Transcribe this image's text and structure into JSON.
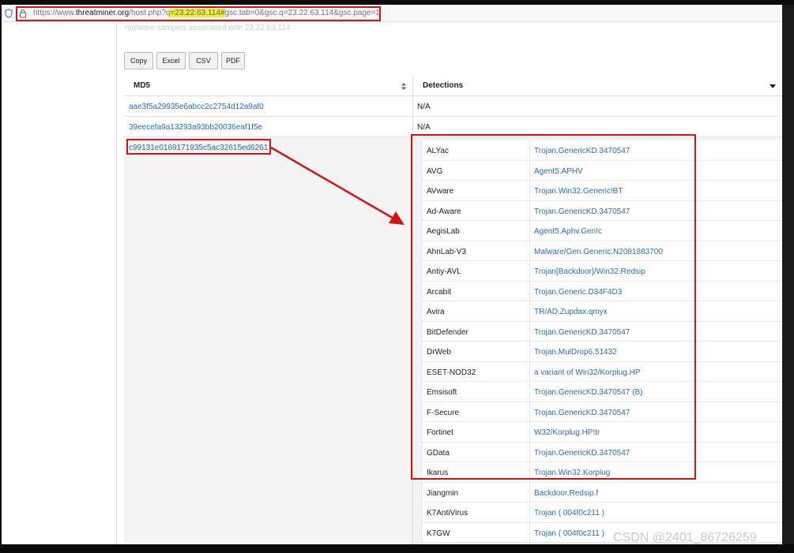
{
  "address_bar": {
    "url_prefix": "https://www.",
    "url_host": "threatminer.org",
    "url_path": "/host.php?q",
    "url_highlight": "=23.22.63.114#",
    "url_rest": "gsc.tab=0&gsc.q=23.22.63.114&gsc.page=1"
  },
  "faded_text": "malware samples associated with 23.22.63.114",
  "toolbar": {
    "buttons": [
      "Copy",
      "Excel",
      "CSV",
      "PDF"
    ]
  },
  "table": {
    "headers": {
      "md5": "MD5",
      "detections": "Detections"
    },
    "rows": [
      {
        "md5": "aae3f5a29935e6abcc2c2754d12a9af0",
        "detections": "N/A"
      },
      {
        "md5": "39eecefa9a13293a93bb20036eaf1f5e",
        "detections": "N/A"
      },
      {
        "md5": "c99131e0169171935c5ac32615ed6261"
      }
    ]
  },
  "detections": [
    {
      "engine": "ALYac",
      "result": "Trojan.GenericKD.3470547"
    },
    {
      "engine": "AVG",
      "result": "Agent5.APHV"
    },
    {
      "engine": "AVware",
      "result": "Trojan.Win32.Generic!BT"
    },
    {
      "engine": "Ad-Aware",
      "result": "Trojan.GenericKD.3470547"
    },
    {
      "engine": "AegisLab",
      "result": "Agent5.Aphv.Gen!c"
    },
    {
      "engine": "AhnLab-V3",
      "result": "Malware/Gen.Generic.N2081883700"
    },
    {
      "engine": "Antiy-AVL",
      "result": "Trojan[Backdoor]/Win32.Redsip"
    },
    {
      "engine": "Arcabit",
      "result": "Trojan.Generic.D34F4D3"
    },
    {
      "engine": "Avira",
      "result": "TR/AD.Zupdax.qmyx"
    },
    {
      "engine": "BitDefender",
      "result": "Trojan.GenericKD.3470547"
    },
    {
      "engine": "DrWeb",
      "result": "Trojan.MulDrop6.51432"
    },
    {
      "engine": "ESET-NOD32",
      "result": "a variant of Win32/Korplug.HP"
    },
    {
      "engine": "Emsisoft",
      "result": "Trojan.GenericKD.3470547 (B)"
    },
    {
      "engine": "F-Secure",
      "result": "Trojan.GenericKD.3470547"
    },
    {
      "engine": "Fortinet",
      "result": "W32/Korplug.HP!tr"
    },
    {
      "engine": "GData",
      "result": "Trojan.GenericKD.3470547"
    },
    {
      "engine": "Ikarus",
      "result": "Trojan.Win32.Korplug"
    },
    {
      "engine": "Jiangmin",
      "result": "Backdoor.Redsip.f"
    },
    {
      "engine": "K7AntiVirus",
      "result": "Trojan ( 004f0c211 )"
    },
    {
      "engine": "K7GW",
      "result": "Trojan ( 004f0c211 )"
    }
  ],
  "watermark": "CSDN @2401_86726259",
  "colors": {
    "annotation_red": "#d21414",
    "link_blue": "#2a6bb3",
    "url_highlight": "#f2ec3a"
  },
  "icons": {
    "address_shield": "shield-icon",
    "address_lock": "lock-icon",
    "md5_sort": "sort-icon",
    "detections_menu": "caret-down-icon"
  }
}
